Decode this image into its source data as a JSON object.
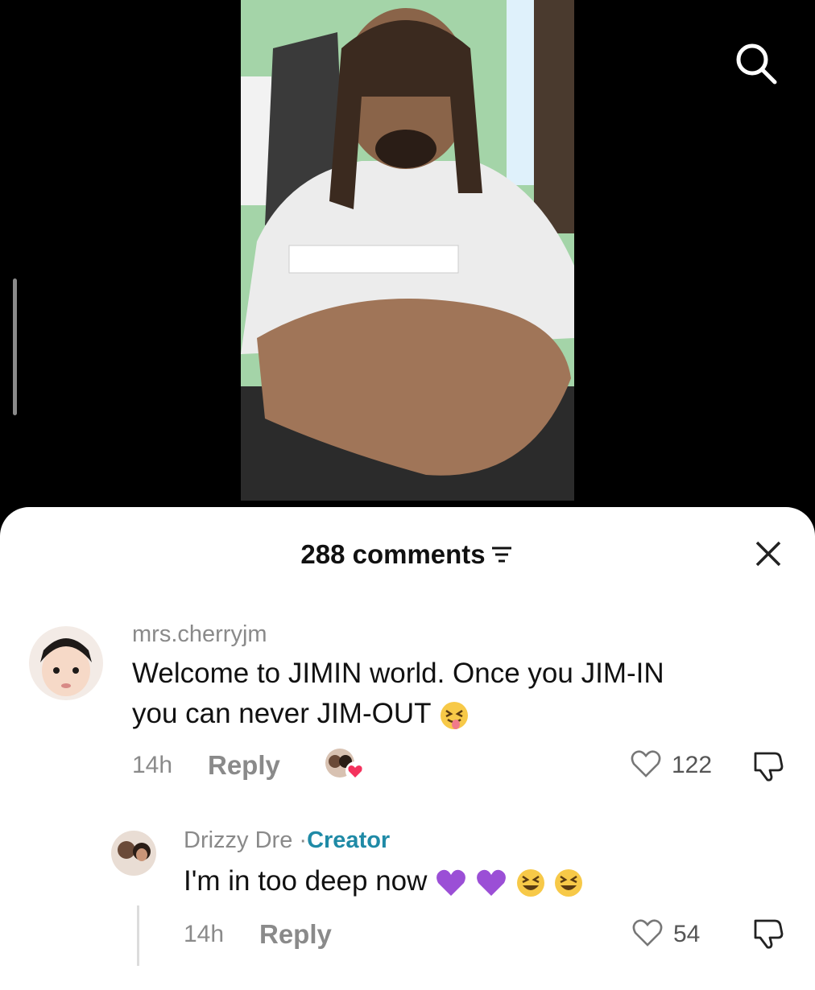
{
  "video": {
    "has_search": true
  },
  "comments_sheet": {
    "count_label": "288 comments",
    "comments": [
      {
        "username": "mrs.cherryjm",
        "text_line1": "Welcome to JIMIN world. Once you JIM-IN",
        "text_line2": "you can never JIM-OUT",
        "emoji": "squinting-tongue-face",
        "time": "14h",
        "reply_label": "Reply",
        "likes": "122"
      },
      {
        "username": "Drizzy Dre",
        "separator": "·",
        "creator_label": "Creator",
        "text": "I'm in too deep now",
        "emojis": [
          "purple-heart",
          "purple-heart",
          "grinning-squinting-face",
          "grinning-squinting-face"
        ],
        "time": "14h",
        "reply_label": "Reply",
        "likes": "54"
      }
    ]
  },
  "colors": {
    "creator": "#1f8aa6",
    "purple_heart": "#9b4fd6",
    "like_heart_red": "#f4325d"
  }
}
